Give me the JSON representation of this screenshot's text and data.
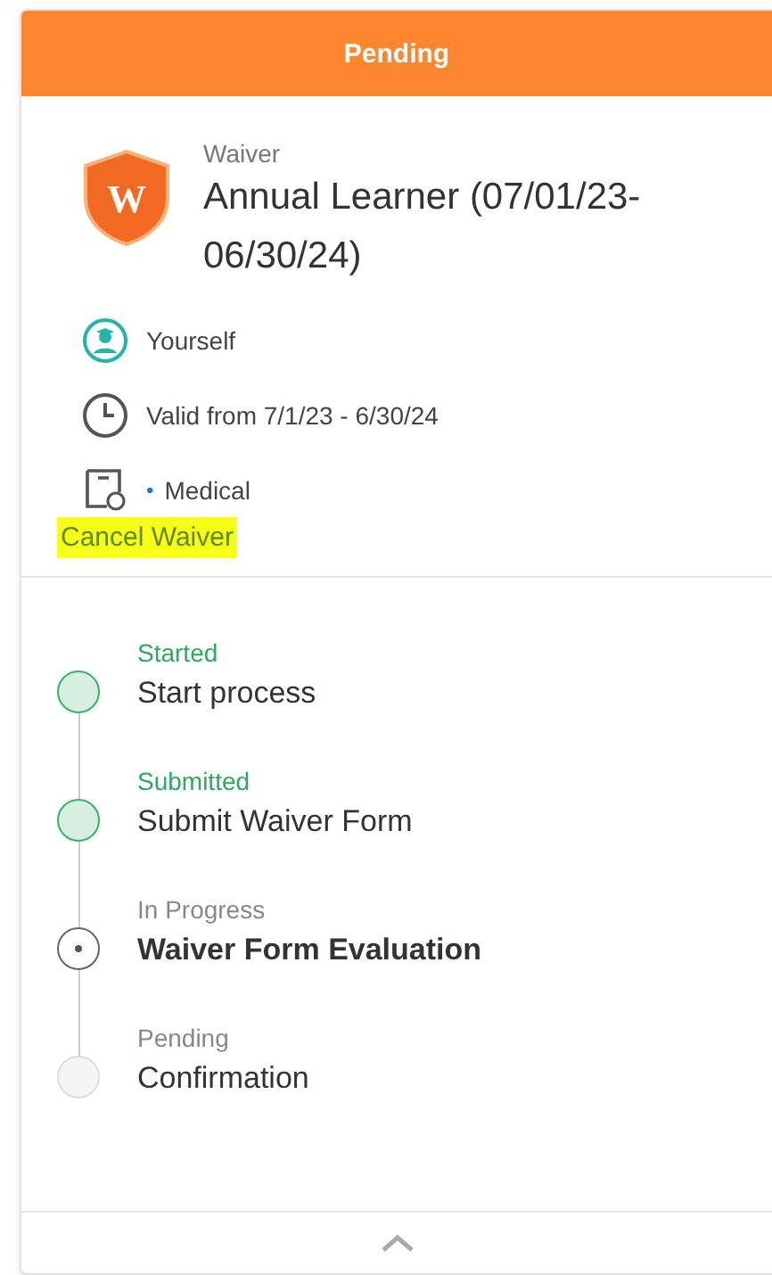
{
  "header": {
    "title": "Pending"
  },
  "waiver": {
    "kind_label": "Waiver",
    "title": "Annual Learner (07/01/23-06/30/24)",
    "badge_letter": "W"
  },
  "details": [
    {
      "kind": "person",
      "text": "Yourself"
    },
    {
      "kind": "clock",
      "text": "Valid from 7/1/23 - 6/30/24"
    },
    {
      "kind": "document",
      "bullet": "•",
      "text": "Medical"
    }
  ],
  "cancel_link": {
    "label": "Cancel Waiver",
    "highlighted": true
  },
  "steps": [
    {
      "kind": "done",
      "status_label": "Started",
      "title": "Start process"
    },
    {
      "kind": "done",
      "status_label": "Submitted",
      "title": "Submit Waiver Form"
    },
    {
      "kind": "current",
      "status_label": "In Progress",
      "title": "Waiver Form Evaluation"
    },
    {
      "kind": "pending",
      "status_label": "Pending",
      "title": "Confirmation"
    }
  ]
}
